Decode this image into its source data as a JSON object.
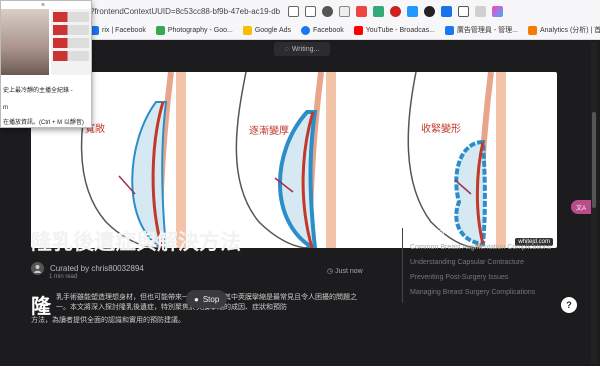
{
  "browser": {
    "url": "?frontendContextUUID=8c53cc88-bf9b-47eb-ac19-db4e2...",
    "bookmarks": [
      {
        "label": "rix | Facebook",
        "color": "#1877f2"
      },
      {
        "label": "Photography - Goo...",
        "color": "#34a853"
      },
      {
        "label": "Google Ads",
        "color": "#fbbc04"
      },
      {
        "label": "Facebook",
        "color": "#1877f2"
      },
      {
        "label": "YouTube - Broadcas...",
        "color": "#ff0000"
      },
      {
        "label": "廣告管理員 - 管理...",
        "color": "#1877f2"
      },
      {
        "label": "Analytics (分析) | 首頁",
        "color": "#f57c00"
      }
    ]
  },
  "popup": {
    "close": "×",
    "line1": "史上最冷靜的主播全紀錄 -",
    "line2": "m",
    "line3": "在播放資訊。(Ctrl + M 以靜音)"
  },
  "writing_label": "Writing...",
  "hero": {
    "labels": [
      "寬敞",
      "逐漸變厚",
      "收緊變形"
    ],
    "watermark": "whitejd.com"
  },
  "article": {
    "title": "隆乳後遺症與解決方法",
    "author": "Curated by chris80032894",
    "read_time": "1 min read",
    "posted": "Just now",
    "drop_cap": "隆",
    "body": "乳手術雖能塑造理想身材，但也可能帶來一些後遺症，其中莢膜攣縮是最常見且令人困擾的問題之一。本文將深入探討隆乳後遺症，特別聚焦於莢膜攣縮的成因、症狀和預防",
    "body_cont": "方法，為讀者提供全面的認識和實用的預防建議。",
    "stop_label": "Stop"
  },
  "toc": [
    "Introduction",
    "Common Breast Augmentation Complications",
    "Understanding Capsular Contracture",
    "Preventing Post-Surgery Issues",
    "Managing Breast Surgery Complications"
  ],
  "help_label": "?",
  "translate_label": "文A"
}
